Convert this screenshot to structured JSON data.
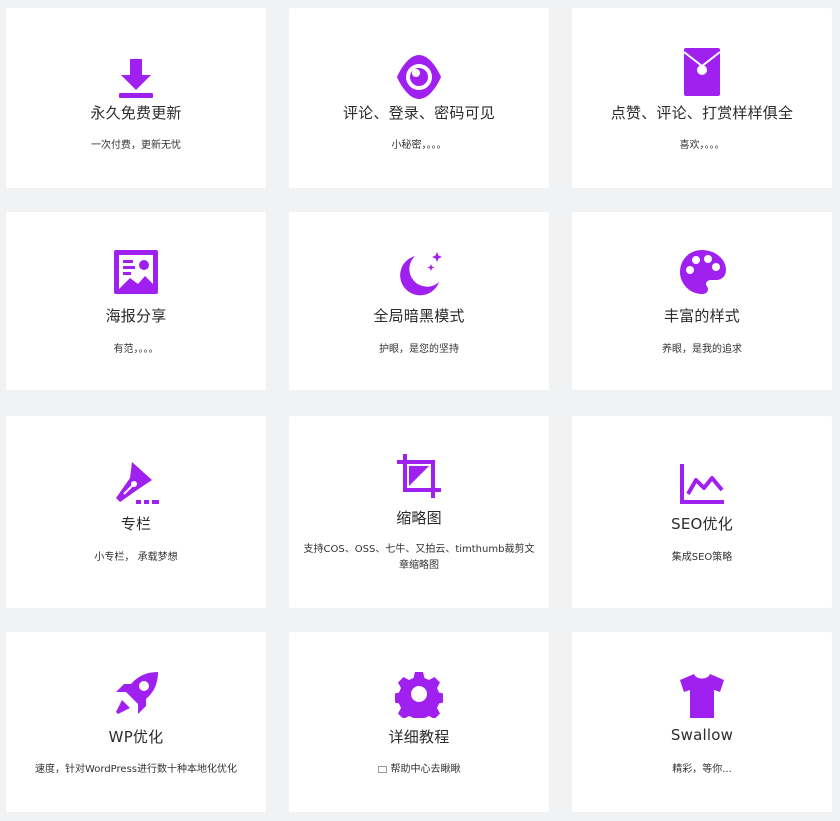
{
  "accent_color": "#a020f0",
  "features": [
    {
      "icon": "download-icon",
      "title": "永久免费更新",
      "desc": "一次付费，更新无忧"
    },
    {
      "icon": "eye-icon",
      "title": "评论、登录、密码可见",
      "desc": "小秘密，。。。"
    },
    {
      "icon": "red-envelope-icon",
      "title": "点赞、评论、打赏样样俱全",
      "desc": "喜欢，。。。"
    },
    {
      "icon": "image-icon",
      "title": "海报分享",
      "desc": "有范，。。。"
    },
    {
      "icon": "moon-stars-icon",
      "title": "全局暗黑模式",
      "desc": "护眼，是您的坚持"
    },
    {
      "icon": "palette-icon",
      "title": "丰富的样式",
      "desc": "养眼，是我的追求"
    },
    {
      "icon": "pen-nib-icon",
      "title": "专栏",
      "desc": "小专栏， 承载梦想"
    },
    {
      "icon": "crop-icon",
      "title": "缩略图",
      "desc": "支持COS、OSS、七牛、又拍云、timthumb裁剪文章缩略图"
    },
    {
      "icon": "line-chart-icon",
      "title": "SEO优化",
      "desc": "集成SEO策略"
    },
    {
      "icon": "rocket-icon",
      "title": "WP优化",
      "desc": "速度，针对WordPress进行数十种本地化优化"
    },
    {
      "icon": "gear-icon",
      "title": "详细教程",
      "desc": "帮助中心去瞅瞅"
    },
    {
      "icon": "tshirt-icon",
      "title": "Swallow",
      "desc": "精彩，等你..."
    }
  ]
}
